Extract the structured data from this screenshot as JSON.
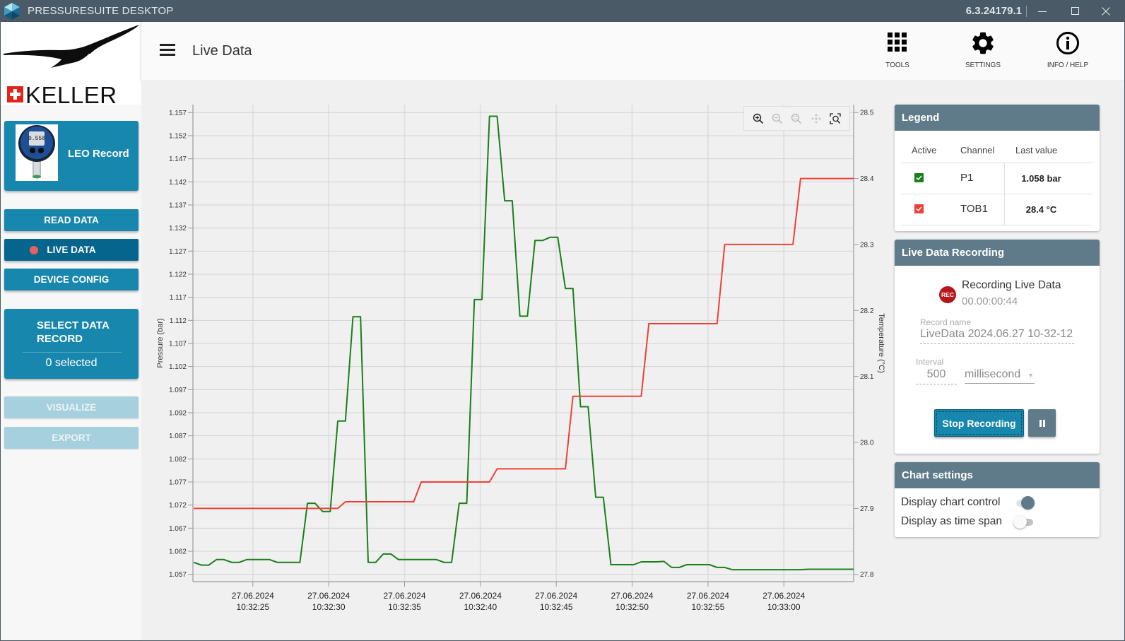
{
  "window": {
    "title": "PRESSURESUITE DESKTOP",
    "version": "6.3.24179.1",
    "controls": [
      "minimize-icon",
      "maximize-icon",
      "close-icon"
    ]
  },
  "sidebar": {
    "logo": {
      "brand": "KELLER",
      "icon": "keller-bird-logo"
    },
    "device": {
      "name": "LEO Record",
      "image": "leo-record-gauge"
    },
    "nav": [
      {
        "label": "READ DATA",
        "active": false
      },
      {
        "label": "LIVE DATA",
        "active": true,
        "indicator_color": "#e5625d"
      },
      {
        "label": "DEVICE CONFIG",
        "active": false
      }
    ],
    "select_record": {
      "title": "SELECT DATA RECORD",
      "count_text": "0 selected"
    },
    "actions": [
      {
        "label": "VISUALIZE",
        "enabled": false
      },
      {
        "label": "EXPORT",
        "enabled": false
      }
    ]
  },
  "header": {
    "menu_icon": "hamburger-icon",
    "title": "Live Data",
    "tools": [
      {
        "label": "TOOLS",
        "icon": "grid-icon"
      },
      {
        "label": "SETTINGS",
        "icon": "gear-icon"
      },
      {
        "label": "INFO / HELP",
        "icon": "info-icon"
      }
    ]
  },
  "chart_toolbar": {
    "buttons": [
      {
        "icon": "zoom-in-icon",
        "enabled": true
      },
      {
        "icon": "zoom-out-icon",
        "enabled": false
      },
      {
        "icon": "zoom-reset-icon",
        "enabled": false
      },
      {
        "icon": "pan-icon",
        "enabled": false
      },
      {
        "icon": "zoom-box-icon",
        "enabled": true
      }
    ]
  },
  "legend": {
    "title": "Legend",
    "columns": [
      "Active",
      "Channel",
      "Last value"
    ],
    "rows": [
      {
        "active": true,
        "color": "#1a7f1a",
        "channel": "P1",
        "last_value": "1.058  bar"
      },
      {
        "active": true,
        "color": "#ee4136",
        "channel": "TOB1",
        "last_value": "28.4 °C"
      }
    ]
  },
  "recording": {
    "title": "Live Data Recording",
    "badge": "REC",
    "status": "Recording Live Data",
    "elapsed": "00.00:00:44",
    "record_name_label": "Record name",
    "record_name": "LiveData 2024.06.27 10-32-12",
    "interval_label": "Interval",
    "interval_value": "500",
    "interval_unit": "millisecond",
    "stop_label": "Stop Recording",
    "pause_icon": "pause-icon"
  },
  "chart_settings": {
    "title": "Chart settings",
    "options": [
      {
        "label": "Display chart control",
        "on": true
      },
      {
        "label": "Display as time span",
        "on": false
      }
    ]
  },
  "chart_data": {
    "type": "line",
    "title": "",
    "grid": true,
    "legend": "external-panel",
    "x_axis": {
      "label": "",
      "unit": "seconds after 27.06.2024 10:32:00",
      "range": [
        21.05,
        64.6
      ],
      "ticks": [
        25,
        30,
        35,
        40,
        45,
        50,
        55,
        60
      ],
      "tick_labels": [
        [
          "27.06.2024",
          "10:32:25"
        ],
        [
          "27.06.2024",
          "10:32:30"
        ],
        [
          "27.06.2024",
          "10:32:35"
        ],
        [
          "27.06.2024",
          "10:32:40"
        ],
        [
          "27.06.2024",
          "10:32:45"
        ],
        [
          "27.06.2024",
          "10:32:50"
        ],
        [
          "27.06.2024",
          "10:32:55"
        ],
        [
          "27.06.2024",
          "10:33:00"
        ]
      ]
    },
    "y_left": {
      "label": "Pressure (bar)",
      "range": [
        1.05542,
        1.15873
      ],
      "ticks": [
        1.057,
        1.062,
        1.067,
        1.072,
        1.077,
        1.082,
        1.087,
        1.092,
        1.097,
        1.102,
        1.107,
        1.112,
        1.117,
        1.122,
        1.127,
        1.132,
        1.137,
        1.142,
        1.147,
        1.152,
        1.157
      ],
      "tick_labels": [
        "1.057",
        "1.062",
        "1.067",
        "1.072",
        "1.077",
        "1.082",
        "1.087",
        "1.092",
        "1.097",
        "1.102",
        "1.107",
        "1.112",
        "1.117",
        "1.122",
        "1.127",
        "1.132",
        "1.137",
        "1.142",
        "1.147",
        "1.152",
        "1.157"
      ]
    },
    "y_right": {
      "label": "Temperature (°C)",
      "range": [
        27.789,
        28.512
      ],
      "ticks": [
        27.8,
        27.9,
        28.0,
        28.1,
        28.2,
        28.3,
        28.4,
        28.5
      ],
      "tick_labels": [
        "27.8",
        "27.9",
        "28.0",
        "28.1",
        "28.2",
        "28.3",
        "28.4",
        "28.5"
      ]
    },
    "x": [
      21.1,
      21.6,
      22.1,
      22.6,
      23.1,
      23.6,
      24.1,
      24.6,
      25.1,
      25.6,
      26.1,
      26.6,
      27.1,
      27.6,
      28.1,
      28.6,
      29.1,
      29.6,
      30.1,
      30.6,
      31.1,
      31.6,
      32.1,
      32.6,
      33.1,
      33.6,
      34.1,
      34.6,
      35.1,
      35.6,
      36.1,
      36.6,
      37.1,
      37.6,
      38.1,
      38.6,
      39.1,
      39.6,
      40.1,
      40.6,
      41.1,
      41.6,
      42.1,
      42.6,
      43.1,
      43.6,
      44.1,
      44.6,
      45.1,
      45.6,
      46.1,
      46.6,
      47.1,
      47.6,
      48.1,
      48.6,
      49.1,
      49.6,
      50.1,
      50.6,
      51.1,
      51.6,
      52.1,
      52.6,
      53.1,
      53.6,
      54.1,
      54.6,
      55.1,
      55.6,
      56.1,
      56.6,
      57.1,
      57.6,
      58.1,
      58.6,
      59.1,
      59.6,
      60.1,
      60.6,
      61.1,
      61.6,
      62.1,
      62.6,
      63.1,
      63.6,
      64.1,
      64.6
    ],
    "series": [
      {
        "name": "P1",
        "axis": "left",
        "unit": "bar",
        "color": "#1a7f1a",
        "values": [
          1.0596,
          1.059,
          1.059,
          1.0602,
          1.0602,
          1.0596,
          1.0596,
          1.0602,
          1.0602,
          1.0602,
          1.0602,
          1.0596,
          1.0596,
          1.0596,
          1.0596,
          1.0724,
          1.0724,
          1.0706,
          1.0706,
          1.0902,
          1.0902,
          1.1128,
          1.1128,
          1.0596,
          1.0596,
          1.0614,
          1.0614,
          1.0602,
          1.0602,
          1.0602,
          1.0602,
          1.0602,
          1.0602,
          1.0596,
          1.0596,
          1.0724,
          1.0724,
          1.1165,
          1.1165,
          1.1562,
          1.1562,
          1.1379,
          1.1379,
          1.1129,
          1.1129,
          1.1293,
          1.1293,
          1.13,
          1.13,
          1.1189,
          1.1189,
          1.0933,
          1.0933,
          1.0737,
          1.0737,
          1.0591,
          1.0591,
          1.0591,
          1.0591,
          1.0597,
          1.0597,
          1.0597,
          1.0598,
          1.0585,
          1.0585,
          1.0591,
          1.0591,
          1.0591,
          1.0591,
          1.0585,
          1.0585,
          1.058,
          1.058,
          1.058,
          1.058,
          1.058,
          1.058,
          1.058,
          1.058,
          1.058,
          1.058,
          1.0581,
          1.0581,
          1.0581,
          1.0581,
          1.0581,
          1.0581,
          1.0581
        ]
      },
      {
        "name": "TOB1",
        "axis": "right",
        "unit": "°C",
        "color": "#ee4136",
        "values": [
          27.9,
          27.9,
          27.9,
          27.9,
          27.9,
          27.9,
          27.9,
          27.9,
          27.9,
          27.9,
          27.9,
          27.9,
          27.9,
          27.9,
          27.9,
          27.9,
          27.9,
          27.9,
          27.9,
          27.9,
          27.91,
          27.91,
          27.91,
          27.91,
          27.91,
          27.91,
          27.91,
          27.91,
          27.91,
          27.91,
          27.94,
          27.94,
          27.94,
          27.94,
          27.94,
          27.94,
          27.94,
          27.94,
          27.94,
          27.94,
          27.96,
          27.96,
          27.96,
          27.96,
          27.96,
          27.96,
          27.96,
          27.96,
          27.96,
          27.96,
          28.07,
          28.07,
          28.07,
          28.07,
          28.07,
          28.07,
          28.07,
          28.07,
          28.07,
          28.07,
          28.18,
          28.18,
          28.18,
          28.18,
          28.18,
          28.18,
          28.18,
          28.18,
          28.18,
          28.18,
          28.3,
          28.3,
          28.3,
          28.3,
          28.3,
          28.3,
          28.3,
          28.3,
          28.3,
          28.3,
          28.4,
          28.4,
          28.4,
          28.4,
          28.4,
          28.4,
          28.4,
          28.4
        ]
      }
    ]
  }
}
